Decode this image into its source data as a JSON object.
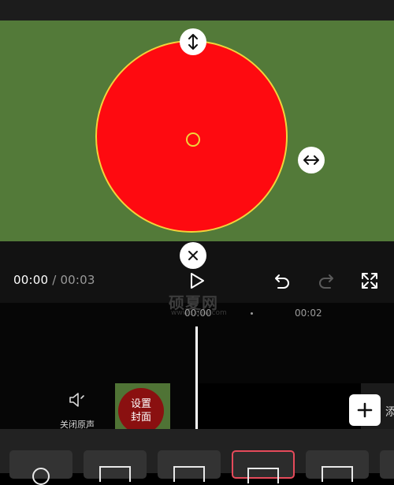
{
  "player": {
    "current_time": "00:00",
    "separator": " / ",
    "total_time": "00:03"
  },
  "watermark": {
    "text": "硕夏网",
    "sub": "www.sxiaw.com"
  },
  "timeline": {
    "ruler": [
      "00:00",
      "00:02"
    ]
  },
  "track": {
    "mute_label": "关闭原声",
    "cover_label_line1": "设置",
    "cover_label_line2": "封面",
    "add_partial_label": "添"
  },
  "canvas": {
    "background": "#537a39",
    "shape_fill": "#fe0a10",
    "shape_outline": "#f2d33a",
    "selected_tile_border": "#e54a5a"
  },
  "icons": [
    "vertical-resize-icon",
    "horizontal-resize-icon",
    "close-icon",
    "play-icon",
    "undo-icon",
    "redo-icon",
    "fullscreen-icon",
    "speaker-icon",
    "plus-icon"
  ]
}
